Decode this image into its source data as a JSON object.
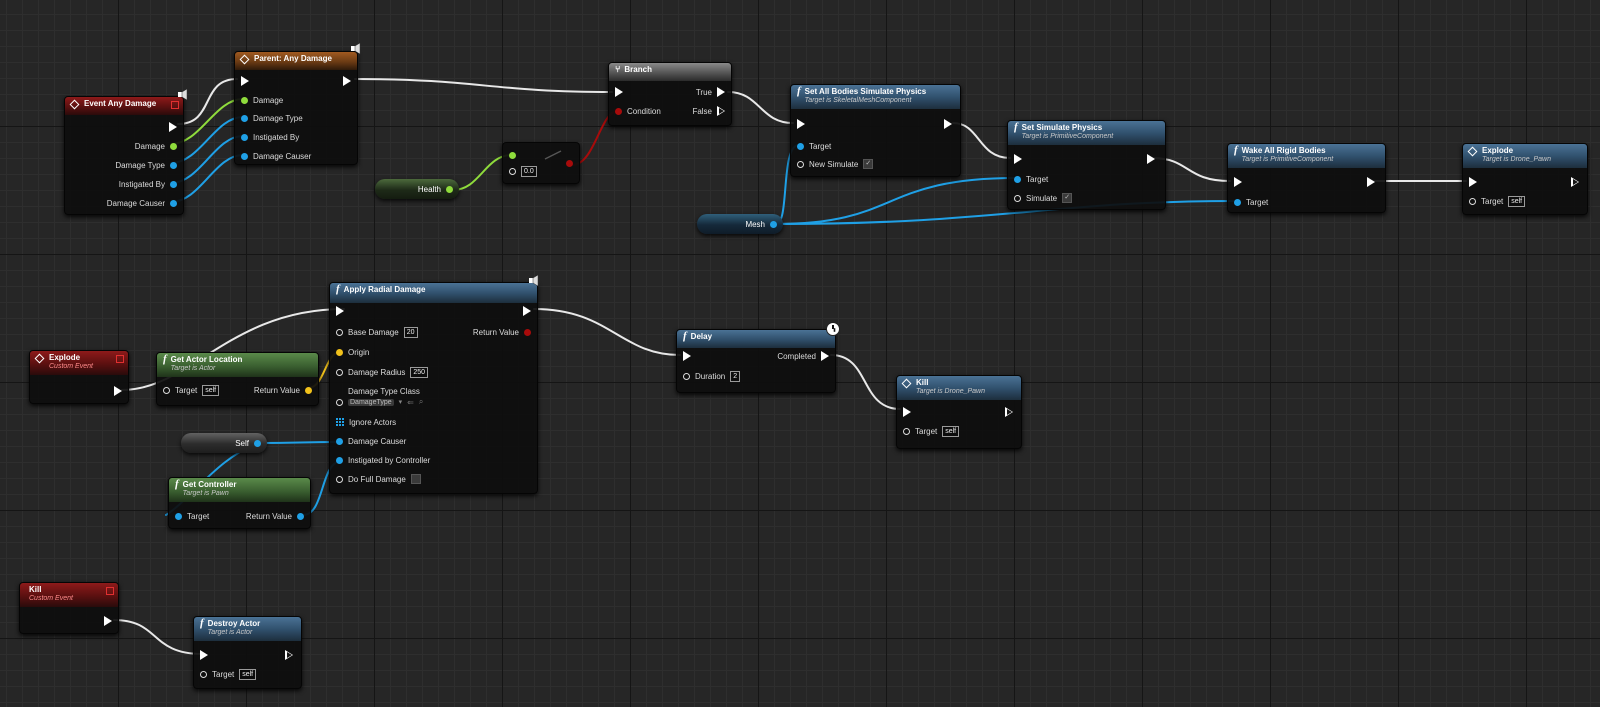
{
  "colors": {
    "exec": "#ffffff",
    "object": "#1fa0e6",
    "struct": "#f2c21b",
    "float": "#8fdc3c",
    "bool": "#a80b0b",
    "class": "#6a1aa0",
    "event_header": "#8e1a1a",
    "function_header": "#4a7295",
    "pure_header": "#5a8a4a",
    "parent_header": "#a15a20"
  },
  "nodes": {
    "event_any_damage": {
      "title": "Event Any Damage",
      "pins": {
        "damage": "Damage",
        "damage_type": "Damage Type",
        "instigated_by": "Instigated By",
        "damage_causer": "Damage Causer"
      }
    },
    "parent_any_damage": {
      "title": "Parent: Any Damage",
      "pins": {
        "damage": "Damage",
        "damage_type": "Damage Type",
        "instigated_by": "Instigated By",
        "damage_causer": "Damage Causer"
      }
    },
    "health_var": {
      "label": "Health"
    },
    "compare": {
      "value": "0.0"
    },
    "branch": {
      "title": "Branch",
      "true": "True",
      "false": "False",
      "condition": "Condition"
    },
    "set_all_bodies": {
      "title": "Set All Bodies Simulate Physics",
      "subtitle": "Target is SkeletalMeshComponent",
      "target": "Target",
      "new_simulate": "New Simulate"
    },
    "mesh_var": {
      "label": "Mesh"
    },
    "set_simulate": {
      "title": "Set Simulate Physics",
      "subtitle": "Target is PrimitiveComponent",
      "target": "Target",
      "simulate": "Simulate"
    },
    "wake_all": {
      "title": "Wake All Rigid Bodies",
      "subtitle": "Target is PrimitiveComponent",
      "target": "Target"
    },
    "explode_call": {
      "title": "Explode",
      "subtitle": "Target is Drone_Pawn",
      "target": "Target",
      "self": "self"
    },
    "explode_event": {
      "title": "Explode",
      "subtitle": "Custom Event"
    },
    "get_actor_location": {
      "title": "Get Actor Location",
      "subtitle": "Target is Actor",
      "target": "Target",
      "self": "self",
      "return": "Return Value"
    },
    "apply_radial": {
      "title": "Apply Radial Damage",
      "base_damage": "Base Damage",
      "base_damage_value": "20",
      "origin": "Origin",
      "damage_radius": "Damage Radius",
      "damage_radius_value": "250",
      "damage_type_class": "Damage Type Class",
      "damage_type_combo": "DamageType",
      "ignore_actors": "Ignore Actors",
      "damage_causer": "Damage Causer",
      "instigated_by": "Instigated by Controller",
      "full_damage": "Do Full Damage",
      "return": "Return Value"
    },
    "self_var": {
      "label": "Self"
    },
    "get_controller": {
      "title": "Get Controller",
      "subtitle": "Target is Pawn",
      "target": "Target",
      "return": "Return Value"
    },
    "delay": {
      "title": "Delay",
      "duration": "Duration",
      "duration_value": "2",
      "completed": "Completed"
    },
    "kill_call": {
      "title": "Kill",
      "subtitle": "Target is Drone_Pawn",
      "target": "Target",
      "self": "self"
    },
    "kill_event": {
      "title": "Kill",
      "subtitle": "Custom Event"
    },
    "destroy_actor": {
      "title": "Destroy Actor",
      "subtitle": "Target is Actor",
      "target": "Target",
      "self": "self"
    }
  }
}
